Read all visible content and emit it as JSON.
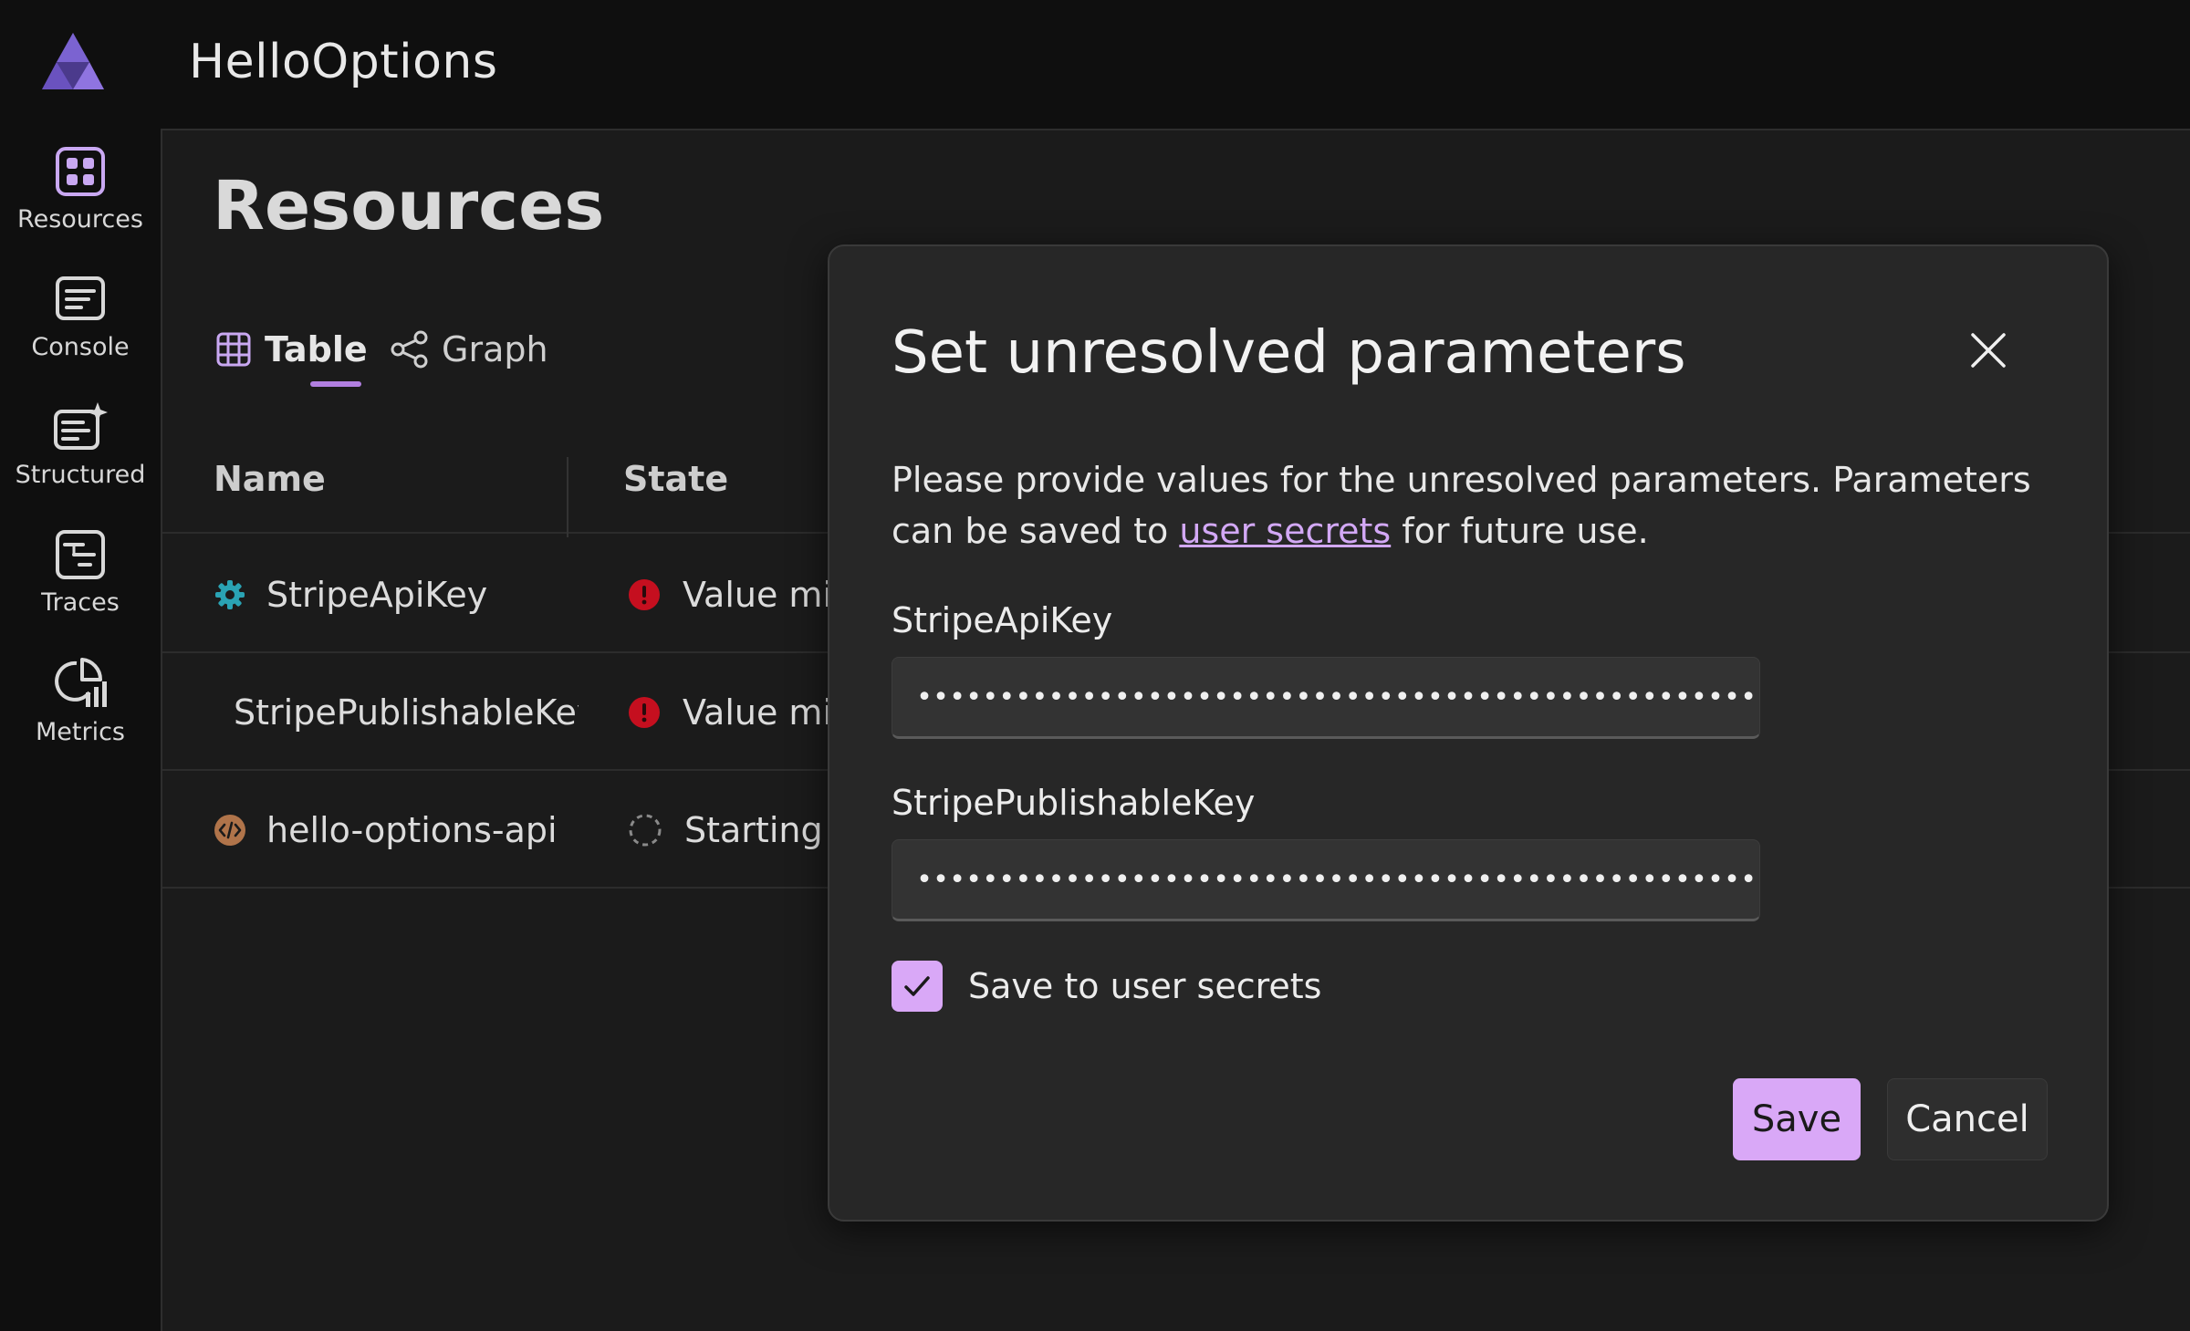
{
  "app": {
    "title": "HelloOptions"
  },
  "nav": {
    "items": [
      {
        "label": "Resources",
        "icon": "resources-icon"
      },
      {
        "label": "Console",
        "icon": "console-icon"
      },
      {
        "label": "Structured",
        "icon": "structured-logs-icon"
      },
      {
        "label": "Traces",
        "icon": "traces-icon"
      },
      {
        "label": "Metrics",
        "icon": "metrics-icon"
      }
    ]
  },
  "page": {
    "title": "Resources",
    "view_tabs": [
      {
        "label": "Table",
        "icon": "table-icon",
        "active": true
      },
      {
        "label": "Graph",
        "icon": "graph-icon",
        "active": false
      }
    ]
  },
  "table": {
    "columns": [
      "Name",
      "State"
    ],
    "rows": [
      {
        "name": "StripeApiKey",
        "state": "Value mis",
        "icon": "parameter-gear-icon",
        "icon_color": "#2aa3b4",
        "state_icon": "error-icon"
      },
      {
        "name": "StripePublishableKey",
        "state": "Value mis",
        "icon": "parameter-gear-icon",
        "icon_color": "#c9a46a",
        "state_icon": "error-icon"
      },
      {
        "name": "hello-options-api",
        "state": "Starting",
        "icon": "project-code-icon",
        "icon_color": "#b0744a",
        "state_icon": "starting-spinner-icon"
      }
    ]
  },
  "dialog": {
    "title": "Set unresolved parameters",
    "description_before_link": "Please provide values for the unresolved parameters. Parameters can be saved to ",
    "description_link": "user secrets",
    "description_after_link": " for future use.",
    "fields": [
      {
        "label": "StripeApiKey",
        "value": "••••••••••••••••••••••••••••••••••••••••••••••••••••••••••"
      },
      {
        "label": "StripePublishableKey",
        "value": "••••••••••••••••••••••••••••••••••••••••••••••••••••••••••"
      }
    ],
    "checkbox": {
      "label": "Save to user secrets",
      "checked": true
    },
    "save_label": "Save",
    "cancel_label": "Cancel"
  },
  "colors": {
    "accent": "#d9a8f7",
    "link": "#d2a8f5",
    "error": "#c50f1f",
    "background": "#1b1b1b",
    "dialog": "#272727"
  }
}
